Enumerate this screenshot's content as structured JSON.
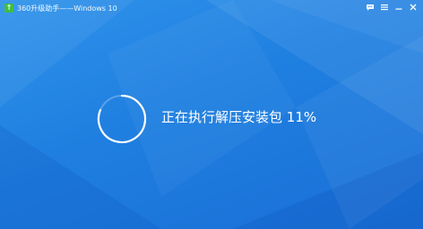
{
  "window": {
    "title": "360升级助手——Windows 10",
    "app_icon": "upgrade-icon",
    "app_icon_glyph": "↑",
    "background_color": "#1f7fe0"
  },
  "titlebar": {
    "buttons": [
      {
        "name": "feedback-icon"
      },
      {
        "name": "menu-icon"
      },
      {
        "name": "minimize-icon"
      },
      {
        "name": "close-icon"
      }
    ]
  },
  "progress": {
    "label": "正在执行解压安装包",
    "percent_text": "11%",
    "percent_value": 11,
    "indicator_icon": "loading-spinner-icon"
  }
}
